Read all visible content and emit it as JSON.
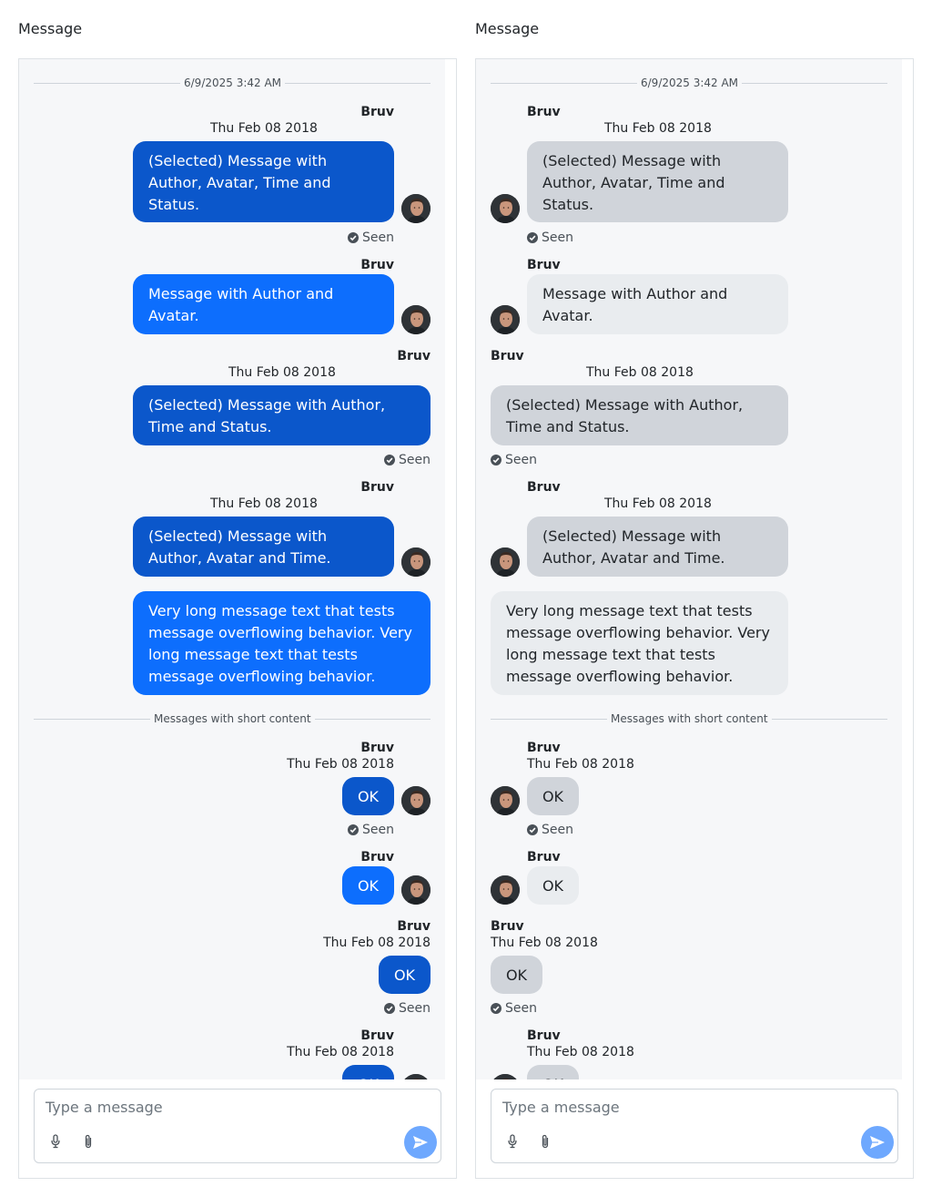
{
  "columns": [
    {
      "title": "Message"
    },
    {
      "title": "Message"
    }
  ],
  "thread": {
    "date_separator": "6/9/2025 3:42 AM",
    "short_separator": "Messages with short content",
    "author": "Bruv",
    "time": "Thu Feb 08 2018",
    "status": "Seen",
    "messages": [
      {
        "text": "(Selected) Message with Author, Avatar, Time and Status."
      },
      {
        "text": "Message with Author and Avatar."
      },
      {
        "text": "(Selected) Message with Author, Time and Status."
      },
      {
        "text": "(Selected) Message with Author, Avatar and Time."
      },
      {
        "text": "Very long message text that tests message overflowing behavior. Very long message text that tests message overflowing behavior."
      }
    ],
    "short_text": "OK"
  },
  "composer": {
    "placeholder": "Type a message"
  },
  "colors": {
    "outgoing_selected": "#0b57cb",
    "outgoing": "#0d6efd",
    "incoming_selected": "#d0d4da",
    "incoming": "#e9ecef",
    "send_button": "#6ea8fe"
  },
  "icons": {
    "status": "check-circle-icon",
    "microphone": "microphone-icon",
    "attach": "paperclip-icon",
    "send": "send-icon"
  }
}
